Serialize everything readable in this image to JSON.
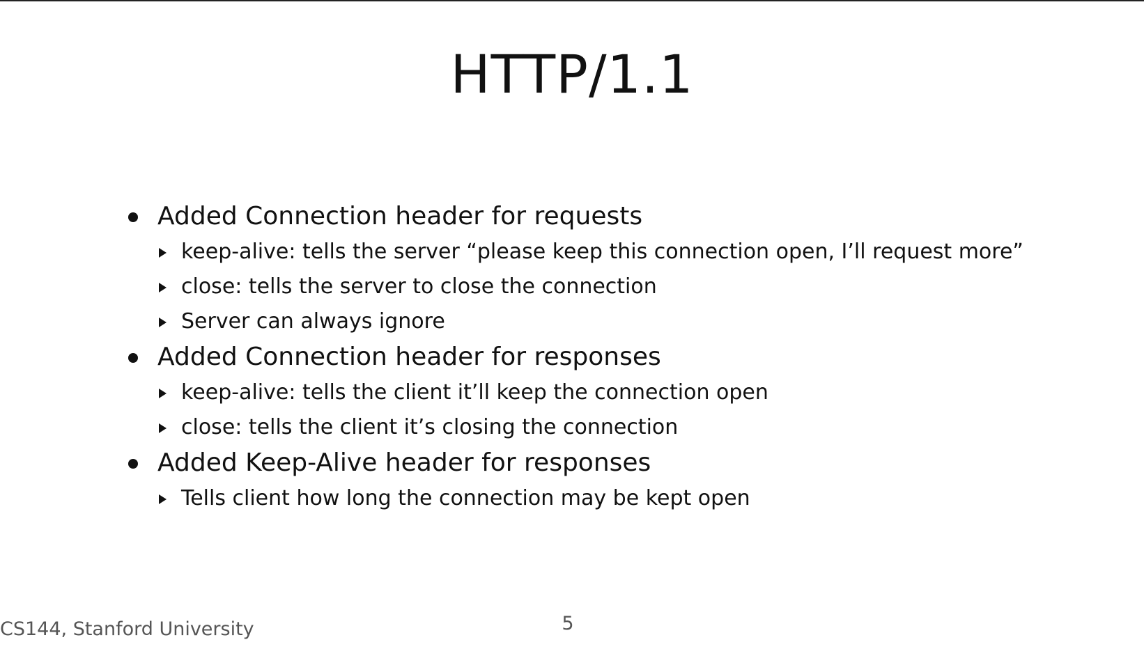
{
  "slide": {
    "title": "HTTP/1.1",
    "sections": [
      {
        "heading": "Added Connection header for requests",
        "items": [
          "keep-alive: tells the server “please keep this connection open, I’ll request more”",
          "close: tells the server to close the connection",
          "Server can always ignore"
        ]
      },
      {
        "heading": "Added Connection header for responses",
        "items": [
          "keep-alive: tells the client it’ll keep the connection open",
          "close: tells the client it’s closing the connection"
        ]
      },
      {
        "heading": "Added Keep-Alive header for responses",
        "items": [
          "Tells client how long the connection may be kept open"
        ]
      }
    ]
  },
  "footer": {
    "course": "CS144, Stanford University",
    "page_number": "5"
  }
}
